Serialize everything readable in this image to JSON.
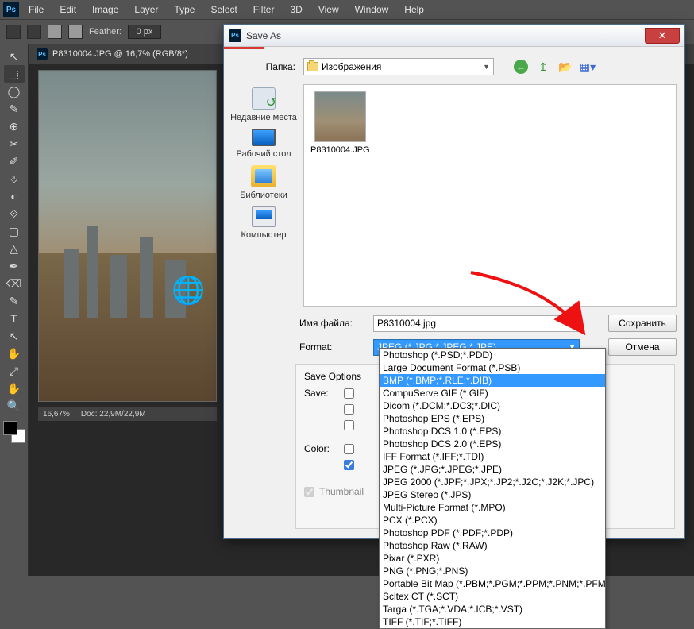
{
  "menubar": [
    "File",
    "Edit",
    "Image",
    "Layer",
    "Type",
    "Select",
    "Filter",
    "3D",
    "View",
    "Window",
    "Help"
  ],
  "options": {
    "feather_label": "Feather:",
    "feather_value": "0 px"
  },
  "doc_tab": "P8310004.JPG @ 16,7% (RGB/8*)",
  "status": {
    "zoom": "16,67%",
    "doc": "Doc: 22,9M/22,9M"
  },
  "tools": [
    "↖",
    "⬚",
    "◯",
    "✎",
    "⊕",
    "✂",
    "✐",
    "⎀",
    "◐",
    "⟐",
    "▢",
    "△",
    "✒",
    "⌫",
    "✎",
    "T",
    "↖",
    "✋",
    "⤢",
    "✋",
    "🔍"
  ],
  "dialog": {
    "title": "Save As",
    "folder_label": "Папка:",
    "folder_value": "Изображения",
    "places": [
      {
        "label": "Недавние места"
      },
      {
        "label": "Рабочий стол"
      },
      {
        "label": "Библиотеки"
      },
      {
        "label": "Компьютер"
      }
    ],
    "thumb_name": "P8310004.JPG",
    "filename_label": "Имя файла:",
    "filename_value": "P8310004.jpg",
    "format_label": "Format:",
    "format_value": "JPEG (*.JPG;*.JPEG;*.JPE)",
    "save_btn": "Сохранить",
    "cancel_btn": "Отмена",
    "save_options_hdr": "Save Options",
    "save_label": "Save:",
    "color_label": "Color:",
    "thumb_label": "Thumbnail"
  },
  "formats": [
    "Photoshop (*.PSD;*.PDD)",
    "Large Document Format (*.PSB)",
    "BMP (*.BMP;*.RLE;*.DIB)",
    "CompuServe GIF (*.GIF)",
    "Dicom (*.DCM;*.DC3;*.DIC)",
    "Photoshop EPS (*.EPS)",
    "Photoshop DCS 1.0 (*.EPS)",
    "Photoshop DCS 2.0 (*.EPS)",
    "IFF Format (*.IFF;*.TDI)",
    "JPEG (*.JPG;*.JPEG;*.JPE)",
    "JPEG 2000 (*.JPF;*.JPX;*.JP2;*.J2C;*.J2K;*.JPC)",
    "JPEG Stereo (*.JPS)",
    "Multi-Picture Format (*.MPO)",
    "PCX (*.PCX)",
    "Photoshop PDF (*.PDF;*.PDP)",
    "Photoshop Raw (*.RAW)",
    "Pixar (*.PXR)",
    "PNG (*.PNG;*.PNS)",
    "Portable Bit Map (*.PBM;*.PGM;*.PPM;*.PNM;*.PFM;*.PAM)",
    "Scitex CT (*.SCT)",
    "Targa (*.TGA;*.VDA;*.ICB;*.VST)",
    "TIFF (*.TIF;*.TIFF)"
  ],
  "format_selected_index": 2,
  "format_checked_index": 9
}
